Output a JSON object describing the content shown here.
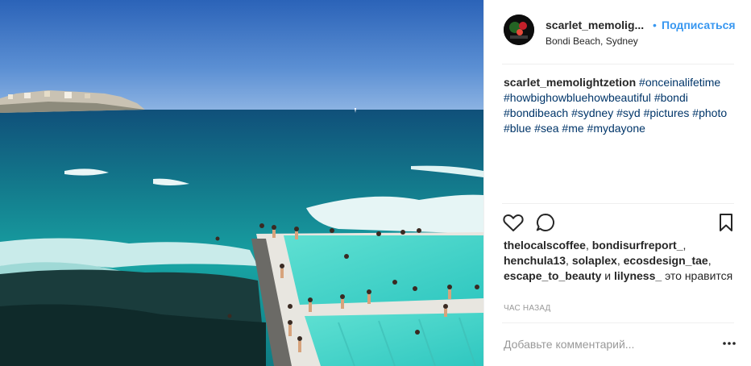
{
  "post": {
    "username": "scarlet_memolig...",
    "follow_dot": "•",
    "follow_label": "Подписаться",
    "location": "Bondi Beach, Sydney"
  },
  "caption": {
    "username": "scarlet_memolightzetion",
    "hashtags": [
      "#onceinalifetime",
      "#howbighowbluehowbeautiful",
      "#bondi",
      "#bondibeach",
      "#sydney",
      "#syd",
      "#pictures",
      "#photo",
      "#blue",
      "#sea",
      "#me",
      "#mydayone"
    ]
  },
  "likes": {
    "users": [
      "thelocalscoffee",
      "bondisurfreport_",
      "henchula13",
      "solaplex",
      "ecosdesign_tae",
      "escape_to_beauty"
    ],
    "last_user": "lilyness_",
    "and_word": "и",
    "suffix": "это нравится"
  },
  "time_label": "час назад",
  "comment": {
    "placeholder": "Добавьте комментарий..."
  },
  "icons": {
    "like": "heart-icon",
    "comment": "comment-icon",
    "save": "bookmark-icon",
    "more": "more-options-icon"
  },
  "colors": {
    "link": "#3897f0",
    "hashtag": "#003569",
    "muted": "#999999"
  }
}
